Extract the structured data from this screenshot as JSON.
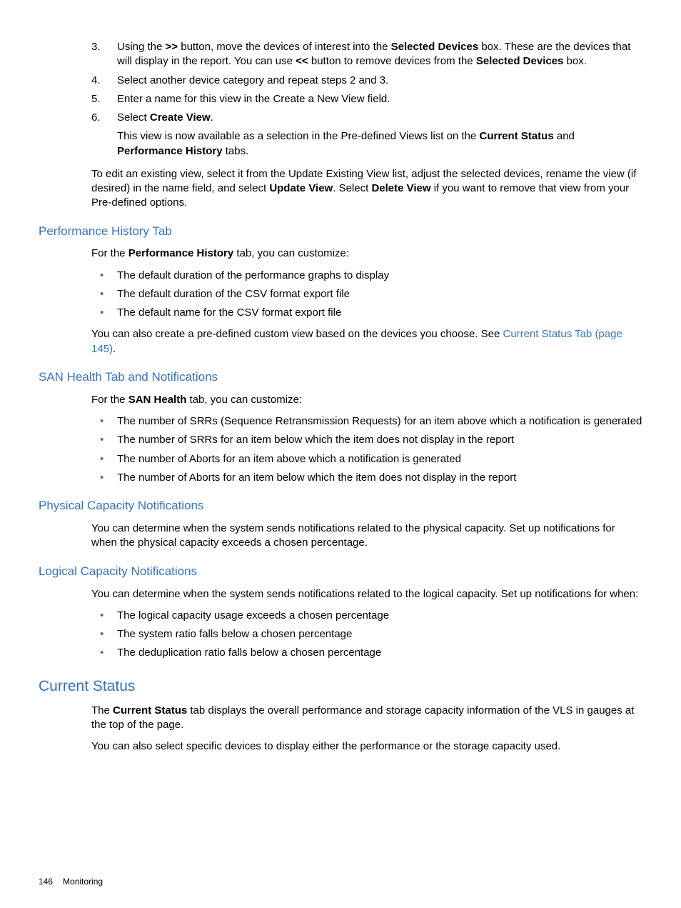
{
  "steps": {
    "s3": {
      "num": "3",
      "t1": "Using the ",
      "b1": ">>",
      "t2": " button, move the devices of interest into the ",
      "b2": "Selected Devices",
      "t3": " box. These are the devices that will display in the report. You can use ",
      "b3": "<<",
      "t4": " button to remove devices from the ",
      "b4": "Selected Devices",
      "t5": " box."
    },
    "s4": {
      "num": "4",
      "text": "Select another device category and repeat steps 2 and 3."
    },
    "s5": {
      "num": "5",
      "text": "Enter a name for this view in the Create a New View field."
    },
    "s6": {
      "num": "6",
      "t1": "Select ",
      "b1": "Create View",
      "t2": ".",
      "sub_t1": "This view is now available as a selection in the Pre-defined Views list on the ",
      "sub_b1": "Current Status",
      "sub_t2": " and ",
      "sub_b2": "Performance History",
      "sub_t3": " tabs."
    }
  },
  "edit_para": {
    "t1": "To edit an existing view, select it from the Update Existing View list, adjust the selected devices, rename the view (if desired) in the name field, and select ",
    "b1": "Update View",
    "t2": ". Select ",
    "b2": "Delete View",
    "t3": " if you want to remove that view from your Pre-defined options."
  },
  "perf": {
    "heading": "Performance History Tab",
    "intro_t1": "For the ",
    "intro_b1": "Performance History",
    "intro_t2": " tab, you can customize:",
    "b1": "The default duration of the performance graphs to display",
    "b2": "The default duration of the CSV format export file",
    "b3": "The default name for the CSV format export file",
    "after_t1": "You can also create a pre-defined custom view based on the devices you choose. See ",
    "after_link": "Current Status Tab (page 145)",
    "after_t2": "."
  },
  "san": {
    "heading": "SAN Health Tab and Notifications",
    "intro_t1": "For the ",
    "intro_b1": "SAN Health",
    "intro_t2": " tab, you can customize:",
    "b1": "The number of SRRs (Sequence Retransmission Requests) for an item above which a notification is generated",
    "b2": "The number of SRRs for an item below which the item does not display in the report",
    "b3": "The number of Aborts for an item above which a notification is generated",
    "b4": "The number of Aborts for an item below which the item does not display in the report"
  },
  "phys": {
    "heading": "Physical Capacity Notifications",
    "text": "You can determine when the system sends notifications related to the physical capacity. Set up notifications for when the physical capacity exceeds a chosen percentage."
  },
  "logical": {
    "heading": "Logical Capacity Notifications",
    "intro": "You can determine when the system sends notifications related to the logical capacity. Set up notifications for when:",
    "b1": "The logical capacity usage exceeds a chosen percentage",
    "b2": "The system ratio falls below a chosen percentage",
    "b3": "The deduplication ratio falls below a chosen percentage"
  },
  "current": {
    "heading": "Current Status",
    "p1_t1": "The ",
    "p1_b1": "Current Status",
    "p1_t2": " tab displays the overall performance and storage capacity information of the VLS in gauges at the top of the page.",
    "p2": "You can also select specific devices to display either the performance or the storage capacity used."
  },
  "footer": {
    "page": "146",
    "section": "Monitoring"
  }
}
